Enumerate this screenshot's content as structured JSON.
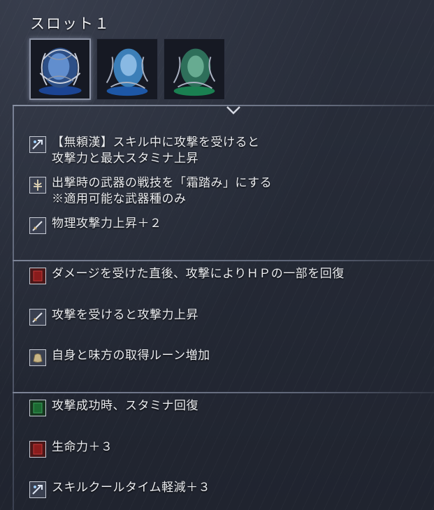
{
  "slot": {
    "title": "スロット１"
  },
  "relics": [
    {
      "name": "relic-1",
      "color": "#4a7ec9",
      "selected": true
    },
    {
      "name": "relic-2",
      "color": "#3a8ed6",
      "selected": false
    },
    {
      "name": "relic-3",
      "color": "#2aa070",
      "selected": false
    }
  ],
  "groups": [
    {
      "effects": [
        {
          "icon": "skill-icon",
          "lines": [
            "【無頼漢】スキル中に攻撃を受けると",
            "攻撃力と最大スタミナ上昇"
          ]
        },
        {
          "icon": "ash-of-war-icon",
          "lines": [
            "出撃時の武器の戦技を「霜踏み」にする",
            "※適用可能な武器種のみ"
          ]
        },
        {
          "icon": "sword-icon",
          "lines": [
            "物理攻撃力上昇＋２"
          ]
        }
      ]
    },
    {
      "effects": [
        {
          "icon": "red-flask-icon",
          "lines": [
            "ダメージを受けた直後、攻撃によりＨＰの一部を回復"
          ]
        },
        {
          "icon": "sword-icon",
          "lines": [
            "攻撃を受けると攻撃力上昇"
          ]
        },
        {
          "icon": "rune-bag-icon",
          "lines": [
            "自身と味方の取得ルーン増加"
          ]
        }
      ]
    },
    {
      "effects": [
        {
          "icon": "green-flask-icon",
          "lines": [
            "攻撃成功時、スタミナ回復"
          ]
        },
        {
          "icon": "red-flask-icon",
          "lines": [
            "生命力＋３"
          ]
        },
        {
          "icon": "skill-icon",
          "lines": [
            "スキルクールタイム軽減＋３"
          ]
        }
      ]
    }
  ]
}
